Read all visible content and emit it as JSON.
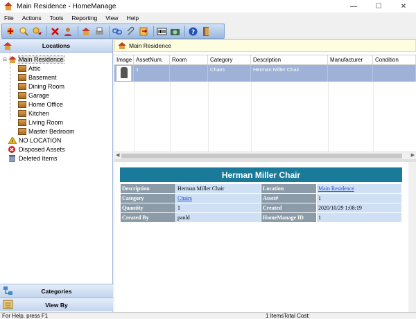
{
  "window": {
    "title": "Main Residence - HomeManage",
    "minimize": "—",
    "maximize": "☐",
    "close": "✕"
  },
  "menu": [
    "File",
    "Actions",
    "Tools",
    "Reporting",
    "View",
    "Help"
  ],
  "toolbar_icons": [
    "add-asset-icon",
    "search-icon",
    "find-next-icon",
    "delete-icon",
    "user-icon",
    "home-icon",
    "print-icon",
    "link-icon",
    "attach-icon",
    "export-icon",
    "barcode-icon",
    "camera-icon",
    "help-icon",
    "exit-icon"
  ],
  "left": {
    "header": "Locations",
    "tree": {
      "root": "Main Residence",
      "rooms": [
        "Attic",
        "Basement",
        "Dining Room",
        "Garage",
        "Home Office",
        "Kitchen",
        "Living Room",
        "Master Bedroom"
      ],
      "no_location": "NO LOCATION",
      "disposed": "Disposed Assets",
      "deleted": "Deleted Items"
    },
    "footer_categories": "Categories",
    "footer_viewby": "View By"
  },
  "path": "Main Residence",
  "grid": {
    "columns": [
      "Image",
      "AssetNum.",
      "Room",
      "Category",
      "Description",
      "Manufacturer",
      "Condition"
    ],
    "rows": [
      {
        "image": "",
        "asset": "1",
        "room": "",
        "category": "Chairs",
        "description": "Herman Miller Chair",
        "manufacturer": "",
        "condition": ""
      }
    ]
  },
  "detail": {
    "title": "Herman Miller Chair",
    "labels": {
      "description": "Description",
      "category": "Category",
      "quantity": "Quantity",
      "created_by": "Created By",
      "location": "Location",
      "asset": "Asset#",
      "created": "Created",
      "hm_id": "HomeManage ID"
    },
    "values": {
      "description": "Herman Miller Chair",
      "category": "Chairs",
      "quantity": "1",
      "created_by": "pauld",
      "location": "Main Residence",
      "asset": "1",
      "created": "2020/10/29 1:08:19",
      "hm_id": "1"
    }
  },
  "status": {
    "help": "For Help, press F1",
    "items": "1 Items",
    "total": "Total Cost:"
  }
}
